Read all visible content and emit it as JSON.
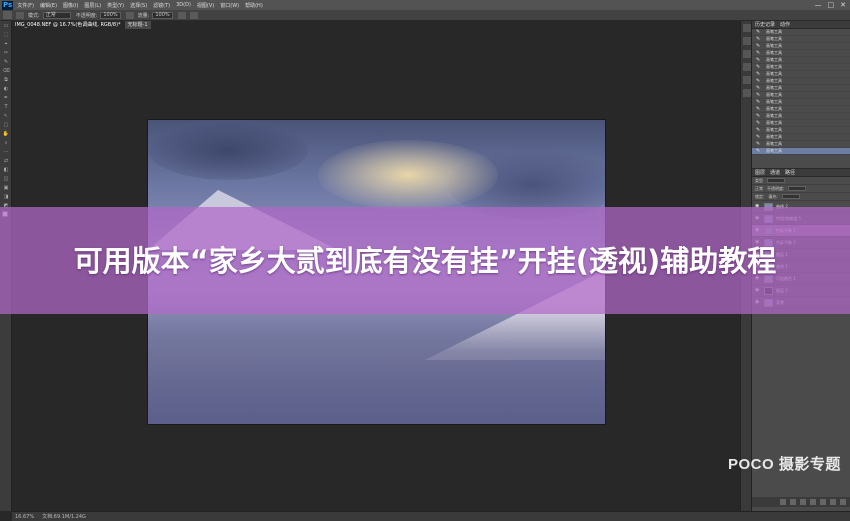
{
  "app": {
    "logo": "Ps",
    "menus": [
      "文件(F)",
      "编辑(E)",
      "图像(I)",
      "图层(L)",
      "类型(Y)",
      "选择(S)",
      "滤镜(T)",
      "3D(D)",
      "视图(V)",
      "窗口(W)",
      "帮助(H)"
    ],
    "window_controls": [
      "—",
      "□",
      "✕"
    ]
  },
  "options_bar": {
    "items": [
      "模式:",
      "正常",
      "不透明度:",
      "100%",
      "流量:",
      "100%"
    ]
  },
  "document": {
    "tabs": [
      {
        "label": "IMG_0048.NEF @ 16.7%(色调曲线, RGB/8)*",
        "active": true
      },
      {
        "label": "无标题-1",
        "active": false
      }
    ]
  },
  "tools": [
    "▭",
    "⬚",
    "⌖",
    "✂",
    "✎",
    "⌫",
    "⧉",
    "◐",
    "✒",
    "T",
    "↖",
    "▢",
    "✋",
    "⌕",
    "⋯",
    "⇄",
    "◧",
    "◫",
    "▣",
    "◨",
    "◩"
  ],
  "history": {
    "tabs": [
      "历史记录",
      "动作"
    ],
    "items": [
      "画笔工具",
      "画笔工具",
      "画笔工具",
      "画笔工具",
      "画笔工具",
      "画笔工具",
      "画笔工具",
      "画笔工具",
      "画笔工具",
      "画笔工具",
      "画笔工具",
      "画笔工具",
      "画笔工具",
      "画笔工具",
      "画笔工具",
      "画笔工具",
      "画笔工具",
      "画笔工具"
    ],
    "active_index": 17
  },
  "layers": {
    "tabs": [
      "图层",
      "通道",
      "路径"
    ],
    "kind_label": "类型",
    "mode_label": "正常",
    "opacity_label": "不透明度:",
    "lock_label": "锁定:",
    "fill_label": "填充:",
    "items": [
      {
        "name": "曲线 2",
        "thumb": "normal",
        "highlight": false
      },
      {
        "name": "色相/饱和度 1",
        "thumb": "normal",
        "highlight": false
      },
      {
        "name": "色彩平衡 1",
        "thumb": "normal",
        "highlight": true
      },
      {
        "name": "色彩平衡 2",
        "thumb": "normal",
        "highlight": false
      },
      {
        "name": "图层 1",
        "thumb": "normal",
        "highlight": false
      },
      {
        "name": "曲线 1",
        "thumb": "normal",
        "highlight": false
      },
      {
        "name": "可选颜色 1",
        "thumb": "normal",
        "highlight": false
      },
      {
        "name": "图层 2",
        "thumb": "dark",
        "highlight": false
      },
      {
        "name": "背景",
        "thumb": "normal",
        "highlight": false
      }
    ]
  },
  "status": {
    "zoom": "16.67%",
    "doc_info": "文档:69.1M/1.24G"
  },
  "overlay": {
    "headline": "可用版本“家乡大贰到底有没有挂”开挂(透视)辅助教程",
    "brand": "POCO 摄影专题"
  }
}
